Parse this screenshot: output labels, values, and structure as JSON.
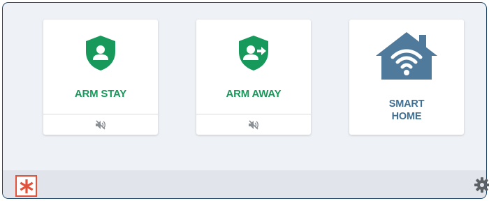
{
  "tiles": [
    {
      "label": "ARM STAY",
      "icon": "shield-person-icon",
      "sub_icon": "speaker-muted-icon"
    },
    {
      "label": "ARM AWAY",
      "icon": "shield-person-arrow-icon",
      "sub_icon": "speaker-muted-icon"
    },
    {
      "label_line1": "SMART",
      "label_line2": "HOME",
      "icon": "house-wifi-icon"
    }
  ],
  "footer": {
    "emergency_icon": "asterisk-icon",
    "settings_icon": "gear-icon"
  },
  "colors": {
    "arm_green": "#16995a",
    "smart_home_blue": "#4f7a9c",
    "emergency_red": "#e2513a",
    "frame_border": "#1f4868"
  }
}
